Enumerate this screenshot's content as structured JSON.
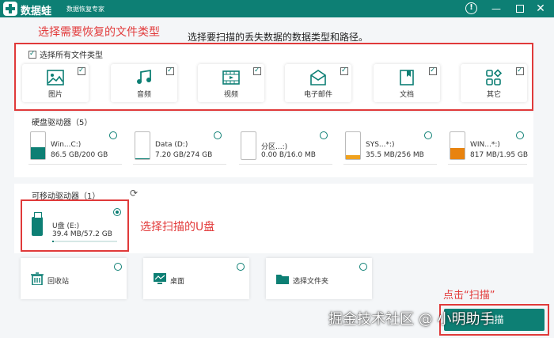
{
  "app": {
    "name": "数据蛙",
    "subtitle": "数据恢复专家"
  },
  "titlebar": {
    "help_icon": "help-circle-icon",
    "minimize_icon": "minimize-icon",
    "maximize_icon": "maximize-icon",
    "close_icon": "close-icon"
  },
  "annotations": {
    "select_types": "选择需要恢复的文件类型",
    "select_usb": "选择扫描的U盘",
    "click_scan": "点击“扫描”"
  },
  "guide_text": "选择要扫描的丢失数据的数据类型和路径。",
  "filetypes": {
    "select_all_label": "选择所有文件类型",
    "select_all_checked": true,
    "items": [
      {
        "label": "图片",
        "icon": "image-icon",
        "checked": true
      },
      {
        "label": "音频",
        "icon": "music-icon",
        "checked": true
      },
      {
        "label": "视频",
        "icon": "video-icon",
        "checked": true
      },
      {
        "label": "电子邮件",
        "icon": "email-icon",
        "checked": true
      },
      {
        "label": "文档",
        "icon": "document-icon",
        "checked": true
      },
      {
        "label": "其它",
        "icon": "grid-icon",
        "checked": true
      }
    ]
  },
  "hard_disks": {
    "title": "硬盘驱动器（5）",
    "items": [
      {
        "name": "Win...C:)",
        "size": "86.5 GB/200 GB",
        "used_fraction": 0.43,
        "color": "#0d7f74"
      },
      {
        "name": "Data (D:)",
        "size": "7.20 GB/274 GB",
        "used_fraction": 0.03,
        "color": "#0d7f74"
      },
      {
        "name": "分区...:)",
        "size": "0.00  B/16.0 MB",
        "used_fraction": 0.0,
        "color": "#0d7f74"
      },
      {
        "name": "SYS...*:)",
        "size": "35.5 MB/256 MB",
        "used_fraction": 0.14,
        "color": "#f0a21e"
      },
      {
        "name": "WIN...*:)",
        "size": "817 MB/1.95 GB",
        "used_fraction": 0.42,
        "color": "#e8830f"
      }
    ]
  },
  "removable": {
    "title": "可移动驱动器（1）",
    "refresh_icon": "refresh-icon",
    "usb": {
      "name": "U盘 (E:)",
      "size": "39.4 MB/57.2 GB",
      "used_fraction": 0.02,
      "selected": true
    }
  },
  "locations": [
    {
      "label": "回收站",
      "icon": "recycle-bin-icon"
    },
    {
      "label": "桌面",
      "icon": "desktop-icon"
    },
    {
      "label": "选择文件夹",
      "icon": "folder-icon"
    }
  ],
  "scan_button": {
    "label": "扫描"
  },
  "watermark": "掘金技术社区 @ 小明助手"
}
